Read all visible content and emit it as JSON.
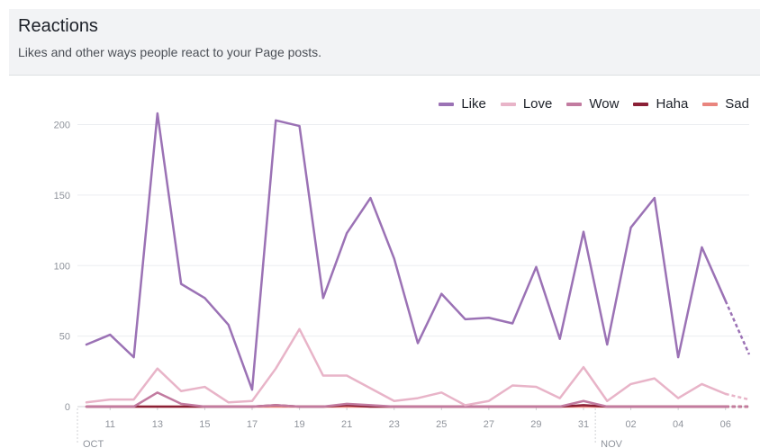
{
  "header": {
    "title": "Reactions",
    "subtitle": "Likes and other ways people react to your Page posts."
  },
  "chart_data": {
    "type": "line",
    "title": "Reactions",
    "subtitle": "Likes and other ways people react to your Page posts.",
    "x": [
      10,
      11,
      12,
      13,
      14,
      15,
      16,
      17,
      18,
      19,
      20,
      21,
      22,
      23,
      24,
      25,
      26,
      27,
      28,
      29,
      30,
      31,
      "Nov 01",
      "Nov 02",
      "Nov 03",
      "Nov 04",
      "Nov 05",
      "Nov 06"
    ],
    "x_tick_labels": [
      "11",
      "13",
      "15",
      "17",
      "19",
      "21",
      "23",
      "25",
      "27",
      "29",
      "31",
      "02",
      "04",
      "06"
    ],
    "month_labels": [
      "OCT",
      "NOV"
    ],
    "y_ticks": [
      0,
      50,
      100,
      150,
      200
    ],
    "ylim": [
      0,
      215
    ],
    "grid": true,
    "legend_position": "top-right",
    "series": [
      {
        "name": "Like",
        "color": "#9b72b5",
        "values": [
          44,
          51,
          35,
          208,
          87,
          77,
          58,
          12,
          203,
          199,
          77,
          123,
          148,
          105,
          45,
          80,
          62,
          63,
          59,
          99,
          48,
          124,
          44,
          127,
          148,
          35,
          113,
          75,
          37
        ]
      },
      {
        "name": "Love",
        "color": "#e8b4c8",
        "values": [
          3,
          5,
          5,
          27,
          11,
          14,
          3,
          4,
          27,
          55,
          22,
          22,
          13,
          4,
          6,
          10,
          1,
          4,
          15,
          14,
          6,
          28,
          4,
          16,
          20,
          6,
          16,
          9,
          5
        ]
      },
      {
        "name": "Wow",
        "color": "#c27ba0",
        "values": [
          0,
          0,
          0,
          10,
          2,
          0,
          0,
          0,
          1,
          0,
          0,
          2,
          1,
          0,
          0,
          0,
          0,
          0,
          0,
          0,
          0,
          4,
          0,
          0,
          0,
          0,
          0,
          0,
          0
        ]
      },
      {
        "name": "Haha",
        "color": "#8b2036",
        "values": [
          0,
          0,
          0,
          0,
          0,
          0,
          0,
          0,
          1,
          0,
          0,
          1,
          0,
          0,
          0,
          0,
          0,
          0,
          0,
          0,
          0,
          1,
          0,
          0,
          0,
          0,
          0,
          0,
          0
        ]
      },
      {
        "name": "Sad",
        "color": "#e9857e",
        "values": [
          0,
          0,
          0,
          0,
          0,
          0,
          0,
          0,
          0,
          0,
          0,
          0,
          0,
          0,
          0,
          0,
          0,
          0,
          0,
          0,
          0,
          0,
          0,
          0,
          0,
          0,
          0,
          0,
          0
        ]
      }
    ]
  }
}
